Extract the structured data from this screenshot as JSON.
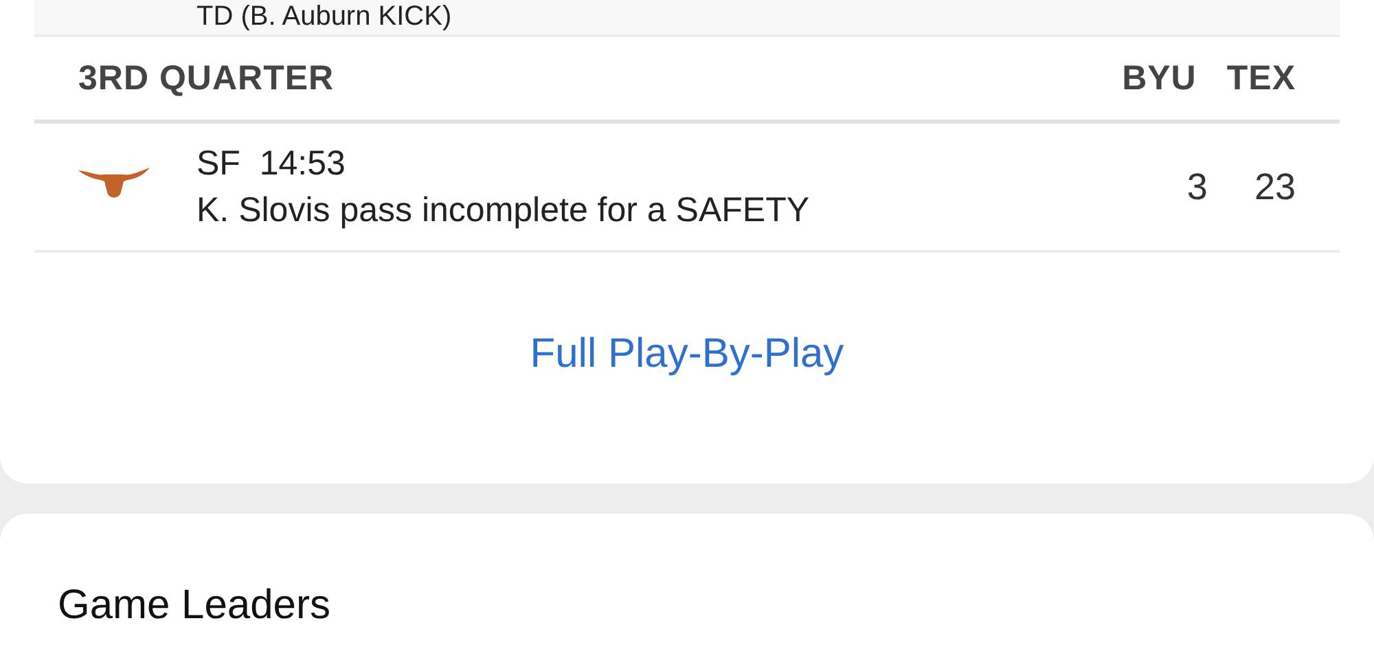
{
  "previous_play": {
    "description": "TD (B. Auburn KICK)"
  },
  "quarter": {
    "title": "3RD QUARTER",
    "teams": [
      "BYU",
      "TEX"
    ]
  },
  "plays": [
    {
      "type": "SF",
      "time": "14:53",
      "description": "K. Slovis pass incomplete for a SAFETY",
      "scores": [
        "3",
        "23"
      ]
    }
  ],
  "link": "Full Play-By-Play",
  "next_section": {
    "title": "Game Leaders"
  }
}
